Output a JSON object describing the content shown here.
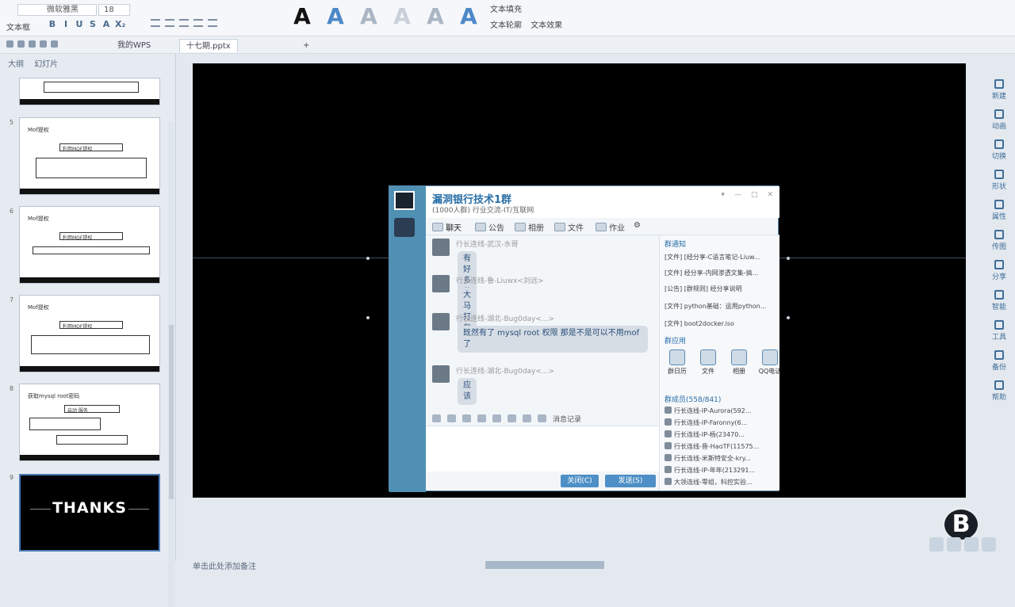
{
  "ribbon": {
    "font_name": "微软雅黑",
    "font_size": "18",
    "textbox_label": "文本框",
    "format_glyphs": [
      "B",
      "I",
      "U",
      "S",
      "A",
      "X₂"
    ],
    "style_letters": [
      "A",
      "A",
      "A",
      "A",
      "A",
      "A"
    ],
    "style_colors": [
      "#111111",
      "#4d88c8",
      "#aab6c4",
      "#c8d0da",
      "#aab6c4",
      "#4d88c8"
    ],
    "text_fill": "文本填充",
    "text_outline": "文本轮廓",
    "text_effect": "文本效果"
  },
  "tabs": {
    "my_wps": "我的WPS",
    "doc": "十七期.pptx",
    "add": "+"
  },
  "left_panel": {
    "tabs": [
      "大纲",
      "幻灯片"
    ],
    "slides": [
      {
        "num": "5",
        "heading": "Mof提权",
        "box": "利用MOF提权"
      },
      {
        "num": "6",
        "heading": "Mof提权",
        "box": "利用MOF提权"
      },
      {
        "num": "7",
        "heading": "Mof提权",
        "box": "利用MOF提权"
      },
      {
        "num": "8",
        "heading": "获取mysql root密码",
        "box": "启动 服务"
      },
      {
        "num": "9",
        "thanks": "THANKS"
      }
    ]
  },
  "qq": {
    "title": "漏洞银行技术1群",
    "subtitle": "(1000人群) 行业交流-IT/互联网",
    "tabs": [
      "聊天",
      "公告",
      "相册",
      "文件",
      "作业"
    ],
    "messages": [
      {
        "who": "行长连线-武汉-水哥",
        "text": "有好多种入门的"
      },
      {
        "who": "行长连线-鲁-Liuwx<刘远>",
        "text": "大马打包"
      },
      {
        "who": "行长连线-湖北-Bug0day<...>",
        "text": "既然有了 mysql root 权限 那是不是可以不用mof了"
      },
      {
        "who": "行长连线-湖北-Bug0day<...>",
        "text": "应该"
      }
    ],
    "toolbar": {
      "history": "消息记录"
    },
    "buttons": {
      "close": "关闭(C)",
      "send": "发送(S)"
    },
    "right": {
      "notice_title": "群通知",
      "notices": [
        "[文件] [经分享-C语言笔记-Liuw...",
        "[文件] 经分享-内网渗透文集-搞...",
        "[公告] [群规则] 经分享说明",
        "[文件] python基础：运用python...",
        "[文件] boot2docker.iso"
      ],
      "apps_title": "群应用",
      "apps": [
        "群日历",
        "文件",
        "相册",
        "QQ电话"
      ],
      "members_title": "群成员(558/841)",
      "members": [
        "行长连线-IP-Aurora(592...",
        "行长连线-IP-Faronny(6...",
        "行长连线-IP-杨(23470...",
        "行长连线-昏-HaoTF(11575...",
        "行长连线-米斯特安全-kry...",
        "行长连线-IP-年年(213291...",
        "大领连线-零组，科控实验..."
      ]
    }
  },
  "sidebar": [
    "新建",
    "动画",
    "切换",
    "形状",
    "属性",
    "传图",
    "分享",
    "智能",
    "工具",
    "备份",
    "帮助"
  ],
  "notes_placeholder": "单击此处添加备注",
  "logo_letter": "B"
}
